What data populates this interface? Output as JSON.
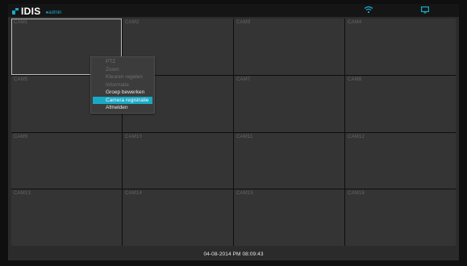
{
  "brand": {
    "name": "IDIS",
    "user_label": "admin",
    "accent": "#19a9c6"
  },
  "toolbar": {
    "wifi_icon": "network-status-icon",
    "monitor_icon": "monitor-icon"
  },
  "cameras": [
    {
      "label": "CAM1"
    },
    {
      "label": "CAM2"
    },
    {
      "label": "CAM3"
    },
    {
      "label": "CAM4"
    },
    {
      "label": "CAM5"
    },
    {
      "label": "CAM6"
    },
    {
      "label": "CAM7"
    },
    {
      "label": "CAM8"
    },
    {
      "label": "CAM9"
    },
    {
      "label": "CAM10"
    },
    {
      "label": "CAM11"
    },
    {
      "label": "CAM12"
    },
    {
      "label": "CAM13"
    },
    {
      "label": "CAM14"
    },
    {
      "label": "CAM15"
    },
    {
      "label": "CAM16"
    }
  ],
  "context_menu": {
    "items": [
      {
        "label": "PTZ",
        "state": "disabled"
      },
      {
        "label": "Zoom",
        "state": "disabled"
      },
      {
        "label": "Kleuren regelen",
        "state": "disabled"
      },
      {
        "label": "Informatie",
        "state": "disabled"
      },
      {
        "label": "Groep bewerken",
        "state": "enabled"
      },
      {
        "label": "Camera registratie",
        "state": "highlighted"
      },
      {
        "label": "Afmelden",
        "state": "enabled"
      }
    ]
  },
  "status": {
    "datetime": "04-08-2014  PM 08:09:43"
  }
}
